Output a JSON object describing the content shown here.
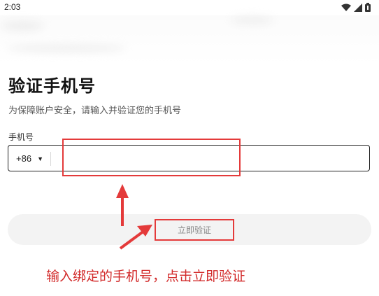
{
  "status_bar": {
    "time": "2:03",
    "icons": [
      "wifi-icon",
      "signal-icon",
      "battery-icon"
    ]
  },
  "page": {
    "title": "验证手机号",
    "subtitle": "为保障账户安全，请输入并验证您的手机号"
  },
  "phone_field": {
    "label": "手机号",
    "country_code": "+86",
    "value": "",
    "placeholder": ""
  },
  "verify_button": {
    "label": "立即验证"
  },
  "annotation": {
    "text": "输入绑定的手机号，点击立即验证"
  },
  "colors": {
    "highlight": "#e43a3a",
    "annotation": "#d22a2a",
    "button_bg": "#f3f3f3"
  }
}
